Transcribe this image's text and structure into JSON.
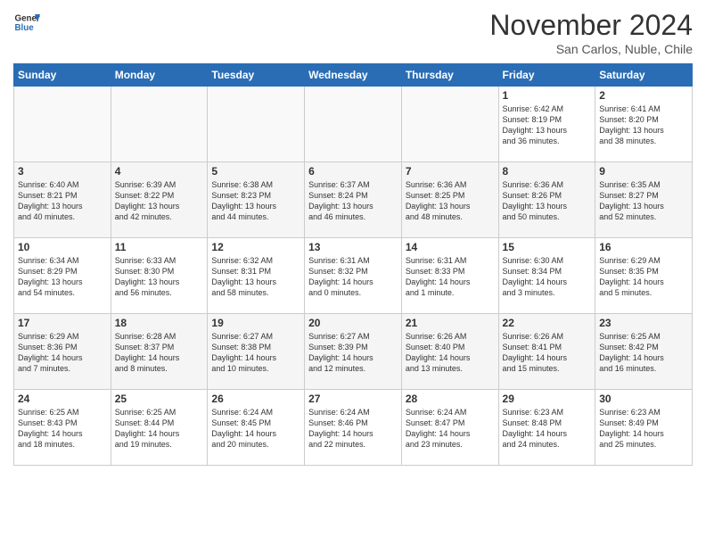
{
  "logo": {
    "line1": "General",
    "line2": "Blue"
  },
  "title": "November 2024",
  "subtitle": "San Carlos, Nuble, Chile",
  "days_of_week": [
    "Sunday",
    "Monday",
    "Tuesday",
    "Wednesday",
    "Thursday",
    "Friday",
    "Saturday"
  ],
  "weeks": [
    [
      {
        "day": "",
        "info": ""
      },
      {
        "day": "",
        "info": ""
      },
      {
        "day": "",
        "info": ""
      },
      {
        "day": "",
        "info": ""
      },
      {
        "day": "",
        "info": ""
      },
      {
        "day": "1",
        "info": "Sunrise: 6:42 AM\nSunset: 8:19 PM\nDaylight: 13 hours\nand 36 minutes."
      },
      {
        "day": "2",
        "info": "Sunrise: 6:41 AM\nSunset: 8:20 PM\nDaylight: 13 hours\nand 38 minutes."
      }
    ],
    [
      {
        "day": "3",
        "info": "Sunrise: 6:40 AM\nSunset: 8:21 PM\nDaylight: 13 hours\nand 40 minutes."
      },
      {
        "day": "4",
        "info": "Sunrise: 6:39 AM\nSunset: 8:22 PM\nDaylight: 13 hours\nand 42 minutes."
      },
      {
        "day": "5",
        "info": "Sunrise: 6:38 AM\nSunset: 8:23 PM\nDaylight: 13 hours\nand 44 minutes."
      },
      {
        "day": "6",
        "info": "Sunrise: 6:37 AM\nSunset: 8:24 PM\nDaylight: 13 hours\nand 46 minutes."
      },
      {
        "day": "7",
        "info": "Sunrise: 6:36 AM\nSunset: 8:25 PM\nDaylight: 13 hours\nand 48 minutes."
      },
      {
        "day": "8",
        "info": "Sunrise: 6:36 AM\nSunset: 8:26 PM\nDaylight: 13 hours\nand 50 minutes."
      },
      {
        "day": "9",
        "info": "Sunrise: 6:35 AM\nSunset: 8:27 PM\nDaylight: 13 hours\nand 52 minutes."
      }
    ],
    [
      {
        "day": "10",
        "info": "Sunrise: 6:34 AM\nSunset: 8:29 PM\nDaylight: 13 hours\nand 54 minutes."
      },
      {
        "day": "11",
        "info": "Sunrise: 6:33 AM\nSunset: 8:30 PM\nDaylight: 13 hours\nand 56 minutes."
      },
      {
        "day": "12",
        "info": "Sunrise: 6:32 AM\nSunset: 8:31 PM\nDaylight: 13 hours\nand 58 minutes."
      },
      {
        "day": "13",
        "info": "Sunrise: 6:31 AM\nSunset: 8:32 PM\nDaylight: 14 hours\nand 0 minutes."
      },
      {
        "day": "14",
        "info": "Sunrise: 6:31 AM\nSunset: 8:33 PM\nDaylight: 14 hours\nand 1 minute."
      },
      {
        "day": "15",
        "info": "Sunrise: 6:30 AM\nSunset: 8:34 PM\nDaylight: 14 hours\nand 3 minutes."
      },
      {
        "day": "16",
        "info": "Sunrise: 6:29 AM\nSunset: 8:35 PM\nDaylight: 14 hours\nand 5 minutes."
      }
    ],
    [
      {
        "day": "17",
        "info": "Sunrise: 6:29 AM\nSunset: 8:36 PM\nDaylight: 14 hours\nand 7 minutes."
      },
      {
        "day": "18",
        "info": "Sunrise: 6:28 AM\nSunset: 8:37 PM\nDaylight: 14 hours\nand 8 minutes."
      },
      {
        "day": "19",
        "info": "Sunrise: 6:27 AM\nSunset: 8:38 PM\nDaylight: 14 hours\nand 10 minutes."
      },
      {
        "day": "20",
        "info": "Sunrise: 6:27 AM\nSunset: 8:39 PM\nDaylight: 14 hours\nand 12 minutes."
      },
      {
        "day": "21",
        "info": "Sunrise: 6:26 AM\nSunset: 8:40 PM\nDaylight: 14 hours\nand 13 minutes."
      },
      {
        "day": "22",
        "info": "Sunrise: 6:26 AM\nSunset: 8:41 PM\nDaylight: 14 hours\nand 15 minutes."
      },
      {
        "day": "23",
        "info": "Sunrise: 6:25 AM\nSunset: 8:42 PM\nDaylight: 14 hours\nand 16 minutes."
      }
    ],
    [
      {
        "day": "24",
        "info": "Sunrise: 6:25 AM\nSunset: 8:43 PM\nDaylight: 14 hours\nand 18 minutes."
      },
      {
        "day": "25",
        "info": "Sunrise: 6:25 AM\nSunset: 8:44 PM\nDaylight: 14 hours\nand 19 minutes."
      },
      {
        "day": "26",
        "info": "Sunrise: 6:24 AM\nSunset: 8:45 PM\nDaylight: 14 hours\nand 20 minutes."
      },
      {
        "day": "27",
        "info": "Sunrise: 6:24 AM\nSunset: 8:46 PM\nDaylight: 14 hours\nand 22 minutes."
      },
      {
        "day": "28",
        "info": "Sunrise: 6:24 AM\nSunset: 8:47 PM\nDaylight: 14 hours\nand 23 minutes."
      },
      {
        "day": "29",
        "info": "Sunrise: 6:23 AM\nSunset: 8:48 PM\nDaylight: 14 hours\nand 24 minutes."
      },
      {
        "day": "30",
        "info": "Sunrise: 6:23 AM\nSunset: 8:49 PM\nDaylight: 14 hours\nand 25 minutes."
      }
    ]
  ]
}
